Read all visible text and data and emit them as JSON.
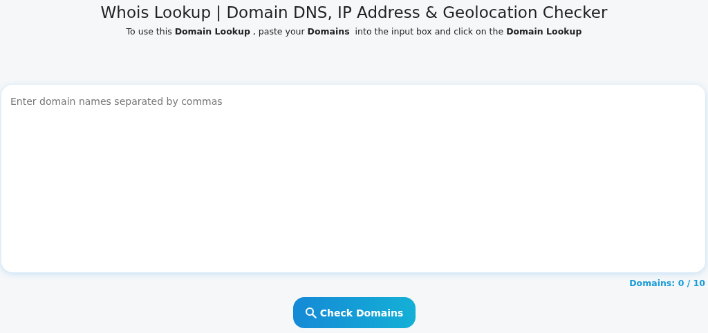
{
  "title": "Whois Lookup | Domain DNS, IP Address & Geolocation Checker",
  "subtitle": "To use this **Domain Lookup** , paste your **Domains**  into the input box and click on the **Domain Lookup**",
  "input": {
    "placeholder": "Enter domain names separated by commas"
  },
  "counter": "Domains: 0 / 10",
  "button": "Check Domains"
}
